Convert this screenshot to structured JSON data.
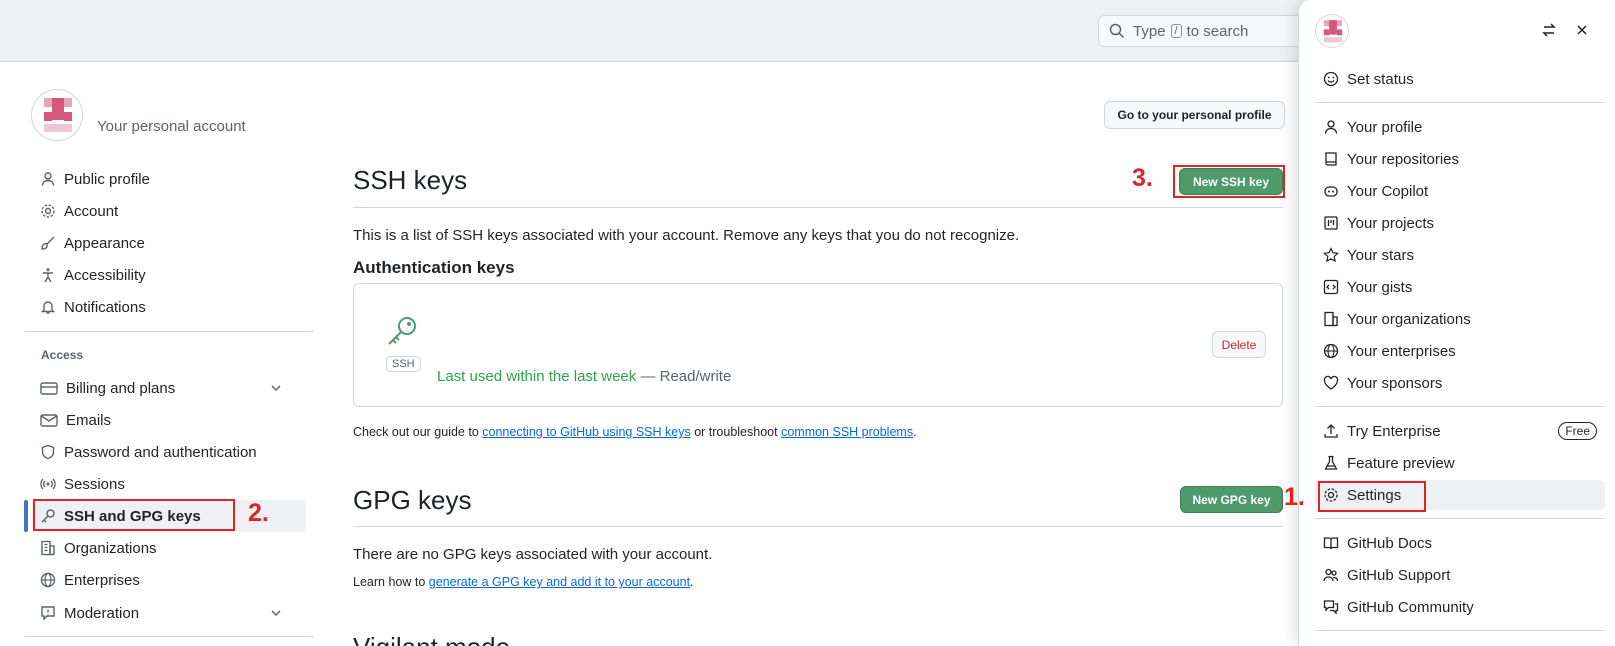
{
  "header": {
    "search_prefix": "Type",
    "search_key": "/",
    "search_suffix": "to search"
  },
  "account": {
    "subtitle": "Your personal account",
    "profile_button": "Go to your personal profile"
  },
  "sidebar": {
    "items": [
      {
        "label": "Public profile",
        "icon": "person-icon"
      },
      {
        "label": "Account",
        "icon": "gear-icon"
      },
      {
        "label": "Appearance",
        "icon": "paintbrush-icon"
      },
      {
        "label": "Accessibility",
        "icon": "accessibility-icon"
      },
      {
        "label": "Notifications",
        "icon": "bell-icon"
      }
    ],
    "access_label": "Access",
    "access_items": [
      {
        "label": "Billing and plans",
        "icon": "credit-card-icon"
      },
      {
        "label": "Emails",
        "icon": "mail-icon"
      },
      {
        "label": "Password and authentication",
        "icon": "shield-icon"
      },
      {
        "label": "Sessions",
        "icon": "broadcast-icon"
      },
      {
        "label": "SSH and GPG keys",
        "icon": "key-icon"
      },
      {
        "label": "Organizations",
        "icon": "organization-icon"
      },
      {
        "label": "Enterprises",
        "icon": "globe-icon"
      },
      {
        "label": "Moderation",
        "icon": "report-icon"
      }
    ]
  },
  "ssh": {
    "title": "SSH keys",
    "new_button": "New SSH key",
    "description": "This is a list of SSH keys associated with your account. Remove any keys that you do not recognize.",
    "auth_title": "Authentication keys",
    "tag": "SSH",
    "last_used": "Last used within the last week",
    "access": "— Read/write",
    "delete_button": "Delete",
    "guide_pre": "Check out our guide to",
    "guide_link1": "connecting to GitHub using SSH keys",
    "guide_mid": "or troubleshoot",
    "guide_link2": "common SSH problems",
    "guide_end": "."
  },
  "gpg": {
    "title": "GPG keys",
    "new_button": "New GPG key",
    "empty": "There are no GPG keys associated with your account.",
    "learn_pre": "Learn how to",
    "learn_link": "generate a GPG key and add it to your account",
    "learn_end": "."
  },
  "vigilant": {
    "title": "Vigilant mode"
  },
  "annotations": {
    "step1": "1.",
    "step2": "2.",
    "step3": "3."
  },
  "menu": {
    "set_status": "Set status",
    "group1": [
      "Your profile",
      "Your repositories",
      "Your Copilot",
      "Your projects",
      "Your stars",
      "Your gists",
      "Your organizations",
      "Your enterprises",
      "Your sponsors"
    ],
    "try_enterprise": "Try Enterprise",
    "free_badge": "Free",
    "feature_preview": "Feature preview",
    "settings": "Settings",
    "group3": [
      "GitHub Docs",
      "GitHub Support",
      "GitHub Community"
    ]
  },
  "colors": {
    "accent_green": "#4f9a6b",
    "annotation_red": "#e02424",
    "link": "#0969da",
    "active_bar": "#3c75c4"
  }
}
